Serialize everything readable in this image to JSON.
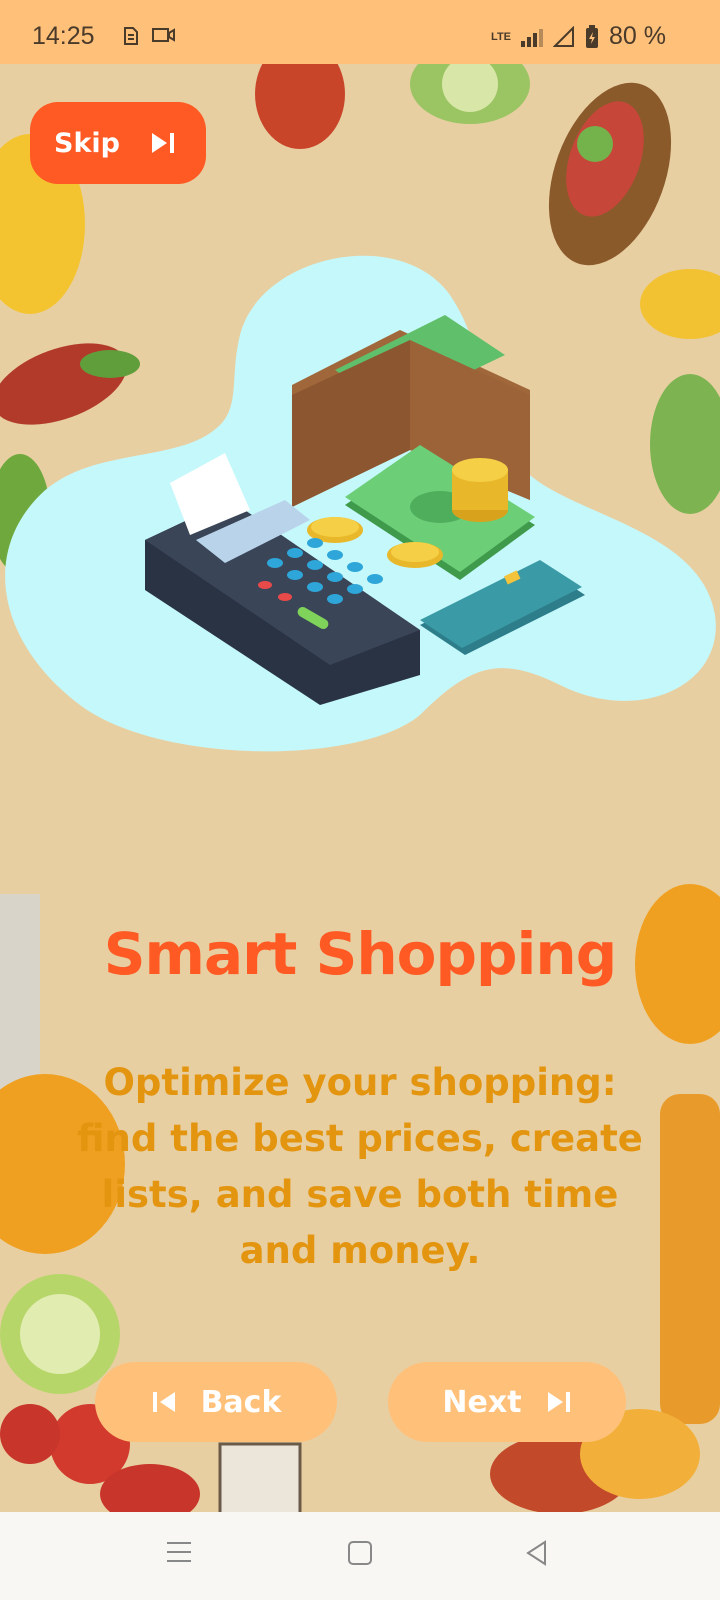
{
  "status_bar": {
    "time": "14:25",
    "network": "LTE",
    "battery": "80 %"
  },
  "skip": {
    "label": "Skip",
    "icon": "skip-forward-icon"
  },
  "onboarding": {
    "title": "Smart Shopping",
    "description": "Optimize your shopping: find the best prices, create lists, and save both time and money."
  },
  "navigation": {
    "back_label": "Back",
    "next_label": "Next"
  },
  "colors": {
    "accent": "#ff5a23",
    "button_bg": "#ffc07a",
    "description": "#e3950f",
    "background": "#e8cfa2"
  }
}
